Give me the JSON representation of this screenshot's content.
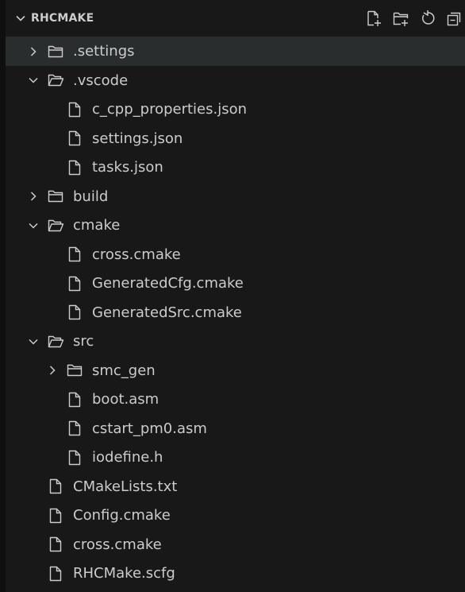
{
  "explorer": {
    "section_title": "RHCMAKE",
    "actions": [
      {
        "name": "new-file-icon"
      },
      {
        "name": "new-folder-icon"
      },
      {
        "name": "refresh-icon"
      },
      {
        "name": "collapse-all-icon"
      }
    ]
  },
  "tree": [
    {
      "label": ".settings",
      "type": "folder",
      "expanded": false,
      "depth": 0,
      "selected": true
    },
    {
      "label": ".vscode",
      "type": "folder",
      "expanded": true,
      "depth": 0
    },
    {
      "label": "c_cpp_properties.json",
      "type": "file",
      "depth": 1
    },
    {
      "label": "settings.json",
      "type": "file",
      "depth": 1
    },
    {
      "label": "tasks.json",
      "type": "file",
      "depth": 1
    },
    {
      "label": "build",
      "type": "folder",
      "expanded": false,
      "depth": 0
    },
    {
      "label": "cmake",
      "type": "folder",
      "expanded": true,
      "depth": 0
    },
    {
      "label": "cross.cmake",
      "type": "file",
      "depth": 1
    },
    {
      "label": "GeneratedCfg.cmake",
      "type": "file",
      "depth": 1
    },
    {
      "label": "GeneratedSrc.cmake",
      "type": "file",
      "depth": 1
    },
    {
      "label": "src",
      "type": "folder",
      "expanded": true,
      "depth": 0
    },
    {
      "label": "smc_gen",
      "type": "folder",
      "expanded": false,
      "depth": 1
    },
    {
      "label": "boot.asm",
      "type": "file",
      "depth": 1
    },
    {
      "label": "cstart_pm0.asm",
      "type": "file",
      "depth": 1
    },
    {
      "label": "iodefine.h",
      "type": "file",
      "depth": 1
    },
    {
      "label": "CMakeLists.txt",
      "type": "file",
      "depth": 0
    },
    {
      "label": "Config.cmake",
      "type": "file",
      "depth": 0
    },
    {
      "label": "cross.cmake",
      "type": "file",
      "depth": 0
    },
    {
      "label": "RHCMake.scfg",
      "type": "file",
      "depth": 0
    }
  ]
}
